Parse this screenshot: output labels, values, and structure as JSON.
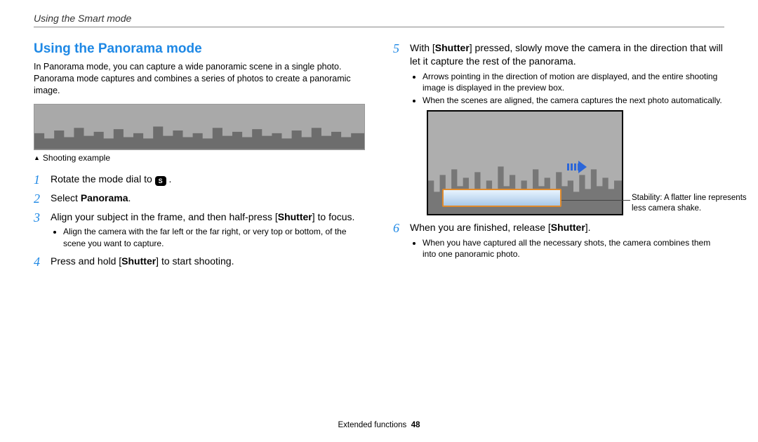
{
  "header": {
    "breadcrumb": "Using the Smart mode"
  },
  "section": {
    "title": "Using the Panorama mode",
    "intro": "In Panorama mode, you can capture a wide panoramic scene in a single photo. Panorama mode captures and combines a series of photos to create a panoramic image.",
    "caption": "Shooting example"
  },
  "steps_left": {
    "s1_a": "Rotate the mode dial to ",
    "s1_b": " .",
    "s_icon_letter": "S",
    "s2_a": "Select ",
    "s2_b": "Panorama",
    "s2_c": ".",
    "s3_a": "Align your subject in the frame, and then half-press [",
    "s3_b": "Shutter",
    "s3_c": "] to focus.",
    "s3_sub1": "Align the camera with the far left or the far right, or very top or bottom, of the scene you want to capture.",
    "s4_a": "Press and hold [",
    "s4_b": "Shutter",
    "s4_c": "] to start shooting."
  },
  "steps_right": {
    "s5_a": "With [",
    "s5_b": "Shutter",
    "s5_c": "] pressed, slowly move the camera in the direction that will let it capture the rest of the panorama.",
    "s5_sub1": "Arrows pointing in the direction of motion are displayed, and the entire shooting image is displayed in the preview box.",
    "s5_sub2": "When the scenes are aligned, the camera captures the next photo automatically.",
    "callout": "Stability: A flatter line represents less camera shake.",
    "s6_a": "When you are finished, release [",
    "s6_b": "Shutter",
    "s6_c": "].",
    "s6_sub1": "When you have captured all the necessary shots, the camera combines them into one panoramic photo."
  },
  "footer": {
    "section": "Extended functions",
    "page": "48"
  }
}
